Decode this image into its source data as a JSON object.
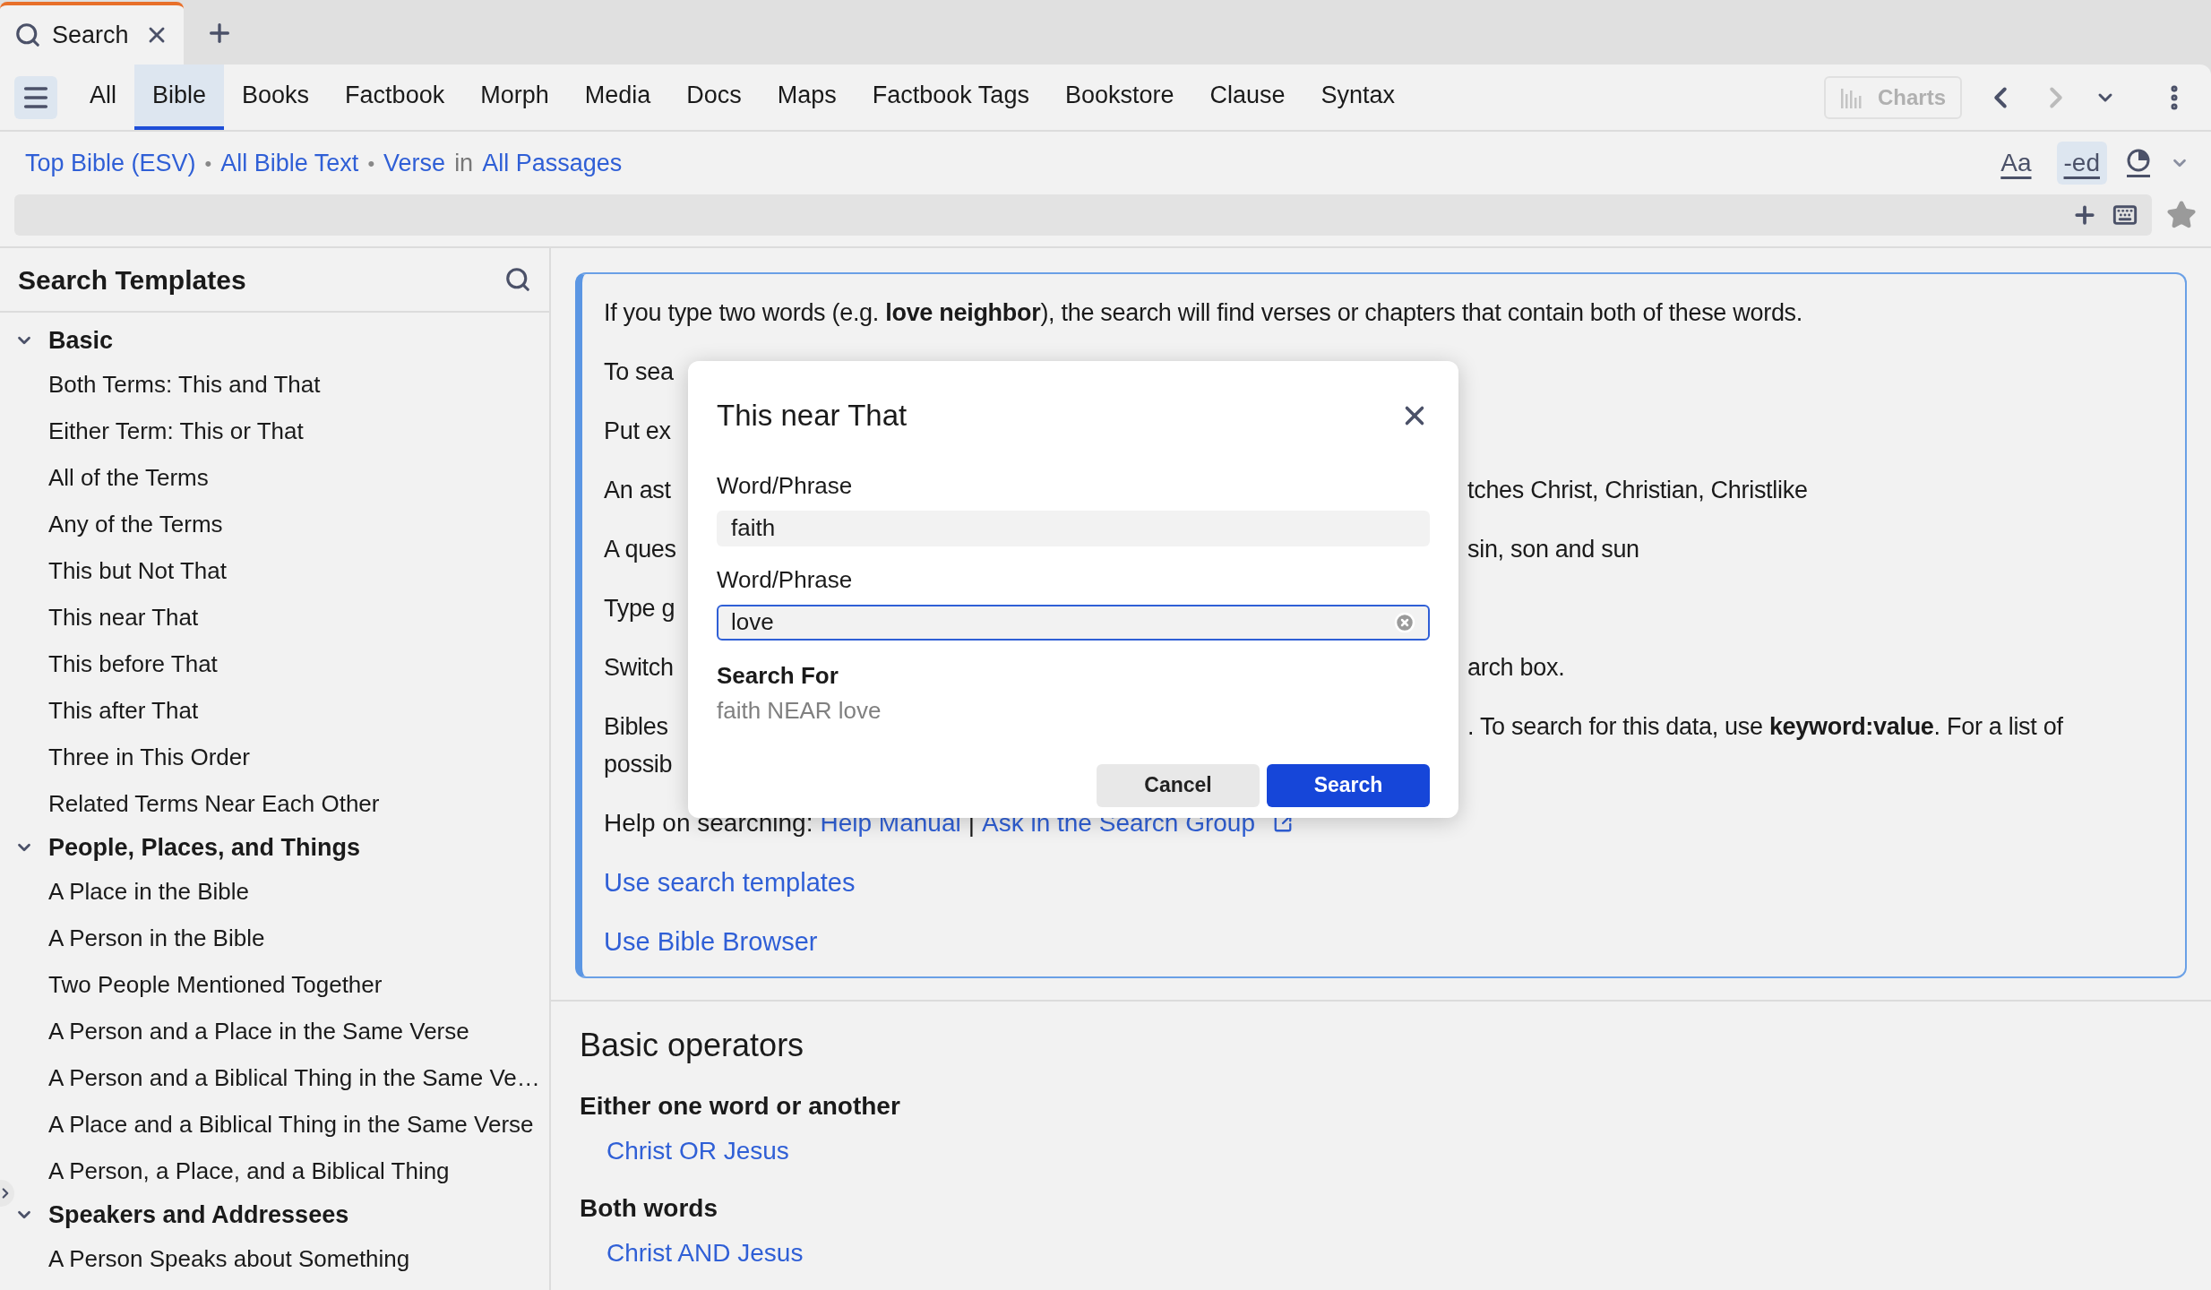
{
  "tab": {
    "label": "Search",
    "selected": true
  },
  "nav": [
    {
      "label": "All",
      "selected": false
    },
    {
      "label": "Bible",
      "selected": true
    },
    {
      "label": "Books",
      "selected": false
    },
    {
      "label": "Factbook",
      "selected": false
    },
    {
      "label": "Morph",
      "selected": false
    },
    {
      "label": "Media",
      "selected": false
    },
    {
      "label": "Docs",
      "selected": false
    },
    {
      "label": "Maps",
      "selected": false
    },
    {
      "label": "Factbook Tags",
      "selected": false
    },
    {
      "label": "Bookstore",
      "selected": false
    },
    {
      "label": "Clause",
      "selected": false
    },
    {
      "label": "Syntax",
      "selected": false
    }
  ],
  "charts": {
    "label": "Charts",
    "disabled": true
  },
  "history": {
    "back_disabled": false,
    "forward_disabled": true
  },
  "breadcrumb": [
    {
      "text": "Top Bible (ESV)",
      "kind": "link"
    },
    {
      "text": "•",
      "kind": "sep"
    },
    {
      "text": "All Bible Text",
      "kind": "link"
    },
    {
      "text": "•",
      "kind": "sep"
    },
    {
      "text": "Verse",
      "kind": "link"
    },
    {
      "text": "in",
      "kind": "plain"
    },
    {
      "text": "All Passages",
      "kind": "link"
    }
  ],
  "view_toggles": [
    {
      "label": "Aa",
      "selected": false
    },
    {
      "label": "-ed",
      "selected": true
    }
  ],
  "sidebar": {
    "title": "Search Templates",
    "groups": [
      {
        "label": "Basic",
        "expanded": true,
        "children": [
          {
            "label": "Both Terms: This and That"
          },
          {
            "label": "Either Term: This or That"
          },
          {
            "label": "All of the Terms"
          },
          {
            "label": "Any of the Terms"
          },
          {
            "label": "This but Not That"
          },
          {
            "label": "This near That"
          },
          {
            "label": "This before That"
          },
          {
            "label": "This after That"
          },
          {
            "label": "Three in This Order"
          },
          {
            "label": "Related Terms Near Each Other"
          }
        ]
      },
      {
        "label": "People, Places, and Things",
        "expanded": true,
        "children": [
          {
            "label": "A Place in the Bible"
          },
          {
            "label": "A Person in the Bible"
          },
          {
            "label": "Two People Mentioned Together"
          },
          {
            "label": "A Person and a Place in the Same Verse"
          },
          {
            "label": "A Person and a Biblical Thing in the Same Ve…"
          },
          {
            "label": "A Place and a Biblical Thing in the Same Verse"
          },
          {
            "label": "A Person, a Place, and a Biblical Thing"
          }
        ]
      },
      {
        "label": "Speakers and Addressees",
        "expanded": true,
        "children": [
          {
            "label": "A Person Speaks about Something"
          }
        ]
      }
    ]
  },
  "info_card": {
    "paragraphs": [
      {
        "lines": [
          {
            "left": "If you type two words (e.g. **love neighbor**), the search will find verses or chapters that contain both of these words."
          }
        ]
      },
      {
        "lines": [
          {
            "left": "To sea"
          }
        ]
      },
      {
        "lines": [
          {
            "left": "Put ex"
          }
        ]
      },
      {
        "lines": [
          {
            "left": "An ast",
            "right": "tches Christ, Christian, Christlike"
          }
        ]
      },
      {
        "lines": [
          {
            "left": "A ques",
            "right": "sin, son and sun"
          }
        ]
      },
      {
        "lines": [
          {
            "left": "Type g"
          }
        ]
      },
      {
        "lines": [
          {
            "left": "Switch",
            "right": "arch box."
          }
        ]
      },
      {
        "lines": [
          {
            "left": "Bibles",
            "right": ". To search for this data, use **keyword:value**. For a list of"
          },
          {
            "left": "possib"
          }
        ]
      }
    ],
    "help": {
      "prefix": "Help on searching:",
      "links": [
        "Help Manual",
        "Ask in the Search Group"
      ],
      "separator": "|"
    },
    "links": [
      "Use search templates",
      "Use Bible Browser"
    ]
  },
  "dialog": {
    "title": "This near That",
    "fields": [
      {
        "label": "Word/Phrase",
        "value": "faith",
        "focused": false
      },
      {
        "label": "Word/Phrase",
        "value": "love",
        "focused": true
      }
    ],
    "search_for_label": "Search For",
    "search_for_value": "faith NEAR love",
    "buttons": [
      {
        "label": "Cancel",
        "kind": "secondary"
      },
      {
        "label": "Search",
        "kind": "primary"
      }
    ]
  },
  "operators": {
    "title": "Basic operators",
    "items": [
      {
        "heading": "Either one word or another",
        "example": "Christ OR Jesus"
      },
      {
        "heading": "Both words",
        "example": "Christ AND Jesus"
      }
    ]
  }
}
